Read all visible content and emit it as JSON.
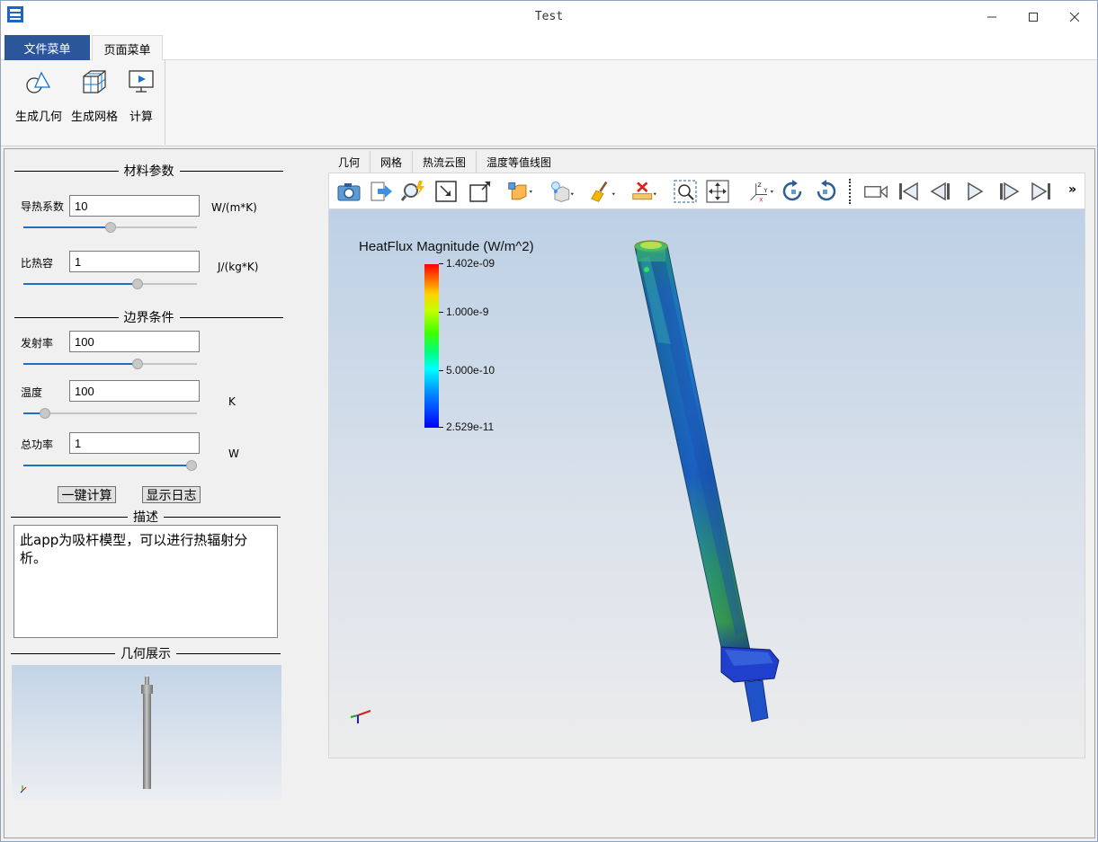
{
  "window": {
    "title": "Test"
  },
  "menu_tabs": [
    {
      "label": "文件菜单"
    },
    {
      "label": "页面菜单"
    }
  ],
  "ribbon": {
    "buttons": [
      {
        "label": "生成几何"
      },
      {
        "label": "生成网格"
      },
      {
        "label": "计算"
      }
    ]
  },
  "material": {
    "title": "材料参数",
    "fields": [
      {
        "label": "导热系数",
        "value": "10",
        "unit": "W/(m*K)",
        "slider": 0.5
      },
      {
        "label": "比热容",
        "value": "1",
        "unit": "J/(kg*K)",
        "slider": 0.67
      }
    ]
  },
  "boundary": {
    "title": "边界条件",
    "fields": [
      {
        "label": "发射率",
        "value": "100",
        "unit": "",
        "slider": 0.67
      },
      {
        "label": "温度",
        "value": "100",
        "unit": "K",
        "slider": 0.1
      },
      {
        "label": "总功率",
        "value": "1",
        "unit": "W",
        "slider": 1.0
      }
    ]
  },
  "actions": {
    "compute": "一键计算",
    "log": "显示日志"
  },
  "description": {
    "title": "描述",
    "text": "此app为吸杆模型，可以进行热辐射分析。"
  },
  "geometry_view": {
    "title": "几何展示"
  },
  "view_tabs": [
    {
      "label": "几何"
    },
    {
      "label": "网格"
    },
    {
      "label": "热流云图"
    },
    {
      "label": "温度等值线图"
    }
  ],
  "toolbar": {
    "icons": [
      "camera-icon",
      "export-arrow-icon",
      "magnifier-spark-icon",
      "reset-zoom-icon",
      "frame-icon",
      "box-cube-icon",
      "light-bulb-icon",
      "brush-icon",
      "clear-ruler-icon",
      "zoom-box-icon",
      "pan-icon",
      "axes-icon",
      "rotate-cw-icon",
      "rotate-ccw-icon",
      "video-camera-icon",
      "first-frame-icon",
      "prev-frame-icon",
      "play-icon",
      "next-frame-icon",
      "last-frame-icon"
    ],
    "overflow": "»"
  },
  "plot": {
    "legend_title": "HeatFlux Magnitude (W/m^2)",
    "ticks": [
      "1.402e-09",
      "1.000e-9",
      "5.000e-10",
      "2.529e-11"
    ],
    "max_value": 1.402e-09,
    "min_value": 2.529e-11
  }
}
